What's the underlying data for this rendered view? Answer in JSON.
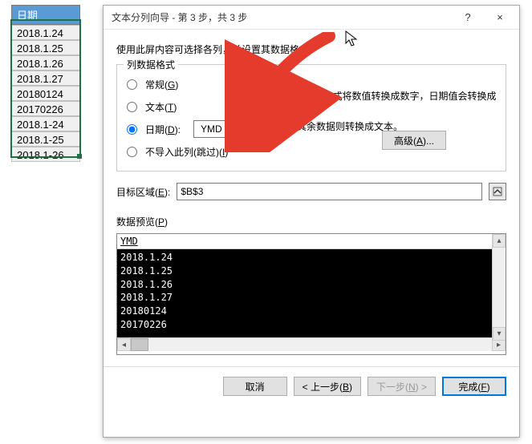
{
  "sheet": {
    "header": "日期",
    "rows": [
      "2018.1.24",
      "2018.1.25",
      "2018.1.26",
      "2018.1.27",
      "20180124",
      "20170226",
      "2018.1-24",
      "2018.1-25",
      "2018.1-26"
    ]
  },
  "dialog": {
    "title": "文本分列向导 - 第 3 步，共 3 步",
    "help": "?",
    "close": "×",
    "description": "使用此屏内容可选择各列，并设置其数据格式。",
    "format_group": {
      "legend": "列数据格式",
      "general": "常规",
      "general_key": "G",
      "text": "文本",
      "text_key": "T",
      "date": "日期",
      "date_key": "D",
      "skip_prefix": "不导入此列(跳过)",
      "skip_key": "I",
      "date_format": "YMD",
      "side1": "\"常规\"数据格式将数值转换成数字，日期值会转换成日",
      "side2": "期，其余数据则转换成文本。",
      "advanced": "高级",
      "advanced_key": "A",
      "advanced_suffix": "..."
    },
    "dest_label": "目标区域",
    "dest_key": "E",
    "dest_value": "$B$3",
    "preview_label": "数据预览",
    "preview_key": "P",
    "preview_header": "YMD",
    "preview_rows": [
      "2018.1.24",
      "2018.1.25",
      "2018.1.26",
      "2018.1.27",
      "20180124",
      "20170226"
    ],
    "buttons": {
      "cancel": "取消",
      "back": "< 上一步",
      "back_key": "B",
      "next": "下一步",
      "next_key": "N",
      "next_suffix": " >",
      "finish": "完成",
      "finish_key": "F"
    }
  }
}
